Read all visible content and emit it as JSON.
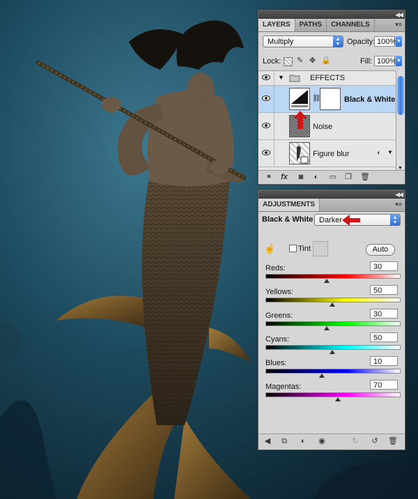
{
  "layers_panel": {
    "tabs": [
      "LAYERS",
      "PATHS",
      "CHANNELS"
    ],
    "blend_mode": "Multiply",
    "opacity_label": "Opacity:",
    "opacity_value": "100%",
    "lock_label": "Lock:",
    "fill_label": "Fill:",
    "fill_value": "100%",
    "layers": [
      {
        "name": "EFFECTS",
        "kind": "group"
      },
      {
        "name": "Black & White",
        "kind": "adjustment",
        "selected": true
      },
      {
        "name": "Noise",
        "kind": "pixel"
      },
      {
        "name": "Figure blur",
        "kind": "smart-object"
      }
    ]
  },
  "adjustments_panel": {
    "tab": "ADJUSTMENTS",
    "title": "Black & White",
    "preset": "Darker",
    "tint_label": "Tint",
    "auto_label": "Auto",
    "sliders": [
      {
        "name": "Reds:",
        "value": 30,
        "min": -200,
        "max": 300,
        "gradient": [
          "#000000",
          "#ff0000"
        ]
      },
      {
        "name": "Yellows:",
        "value": 50,
        "min": -200,
        "max": 300,
        "gradient": [
          "#000000",
          "#ffff00"
        ]
      },
      {
        "name": "Greens:",
        "value": 30,
        "min": -200,
        "max": 300,
        "gradient": [
          "#000000",
          "#00ff00"
        ]
      },
      {
        "name": "Cyans:",
        "value": 50,
        "min": -200,
        "max": 300,
        "gradient": [
          "#000000",
          "#00ffff"
        ]
      },
      {
        "name": "Blues:",
        "value": 10,
        "min": -200,
        "max": 300,
        "gradient": [
          "#000000",
          "#0000ff"
        ]
      },
      {
        "name": "Magentas:",
        "value": 70,
        "min": -200,
        "max": 300,
        "gradient": [
          "#000000",
          "#ff00ff"
        ]
      }
    ]
  },
  "colors": {
    "selection": "#bcd6f6",
    "accent_blue": "#2f6bd6",
    "red_arrow": "#d01515"
  }
}
